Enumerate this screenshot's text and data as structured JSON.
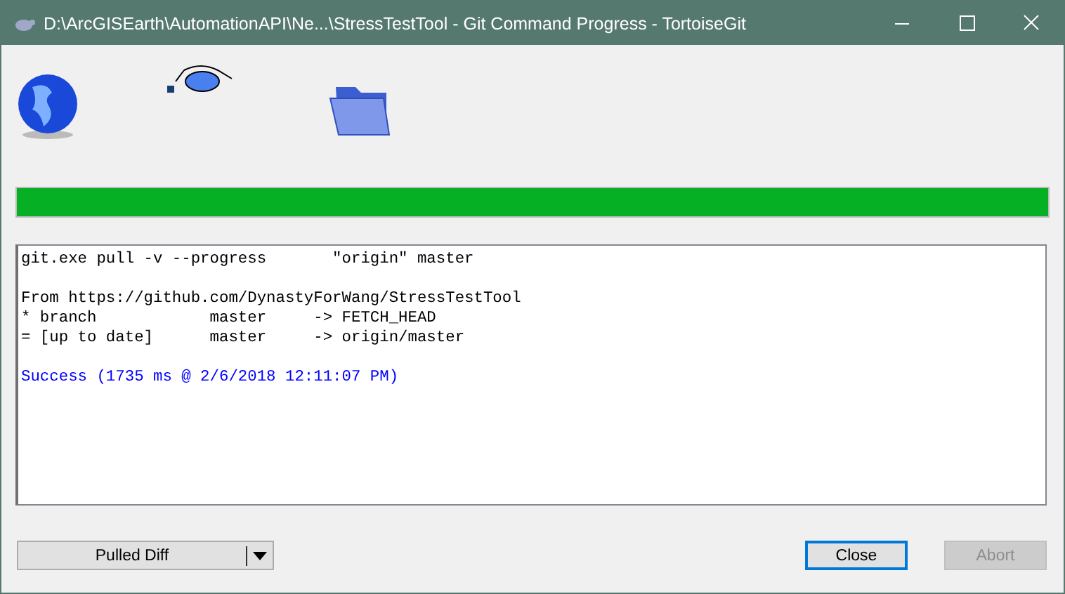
{
  "window": {
    "title": "D:\\ArcGISEarth\\AutomationAPI\\Ne...\\StressTestTool - Git Command Progress - TortoiseGit"
  },
  "progress": {
    "level": 1
  },
  "log": [
    {
      "kind": "command",
      "text": "git.exe pull -v --progress       \"origin\" master"
    },
    {
      "kind": "blank"
    },
    {
      "kind": "info",
      "text": "From https://github.com/DynastyForWang/StressTestTool"
    },
    {
      "kind": "info",
      "text": "* branch            master     -> FETCH_HEAD"
    },
    {
      "kind": "info",
      "text": "= [up to date]      master     -> origin/master"
    },
    {
      "kind": "blank"
    },
    {
      "kind": "success",
      "text": "Success (1735 ms @ 2/6/2018 12:11:07 PM)"
    }
  ],
  "buttons": [
    {
      "kind": "split",
      "label": "Pulled Diff",
      "disabled": false,
      "default": false
    },
    {
      "kind": "push",
      "label": "Close",
      "disabled": false,
      "default": true
    },
    {
      "kind": "push",
      "label": "Abort",
      "disabled": true,
      "default": false
    }
  ]
}
